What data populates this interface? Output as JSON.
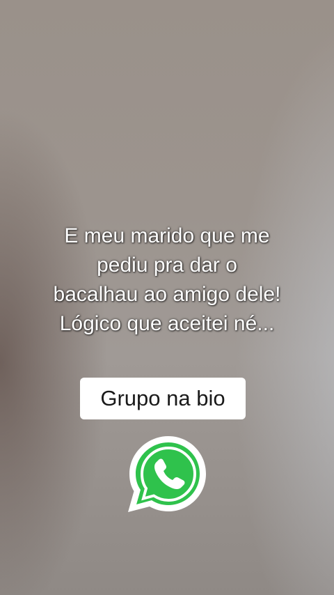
{
  "caption": {
    "lines": [
      "E meu marido que me",
      "pediu pra dar o",
      "bacalhau ao amigo dele!",
      "Lógico que aceitei né..."
    ]
  },
  "cta": {
    "label": "Grupo na bio"
  },
  "icons": {
    "messenger": "whatsapp-icon"
  },
  "colors": {
    "whatsapp_green": "#2fc24c",
    "cta_background": "#ffffff",
    "caption_text": "#ffffff"
  }
}
